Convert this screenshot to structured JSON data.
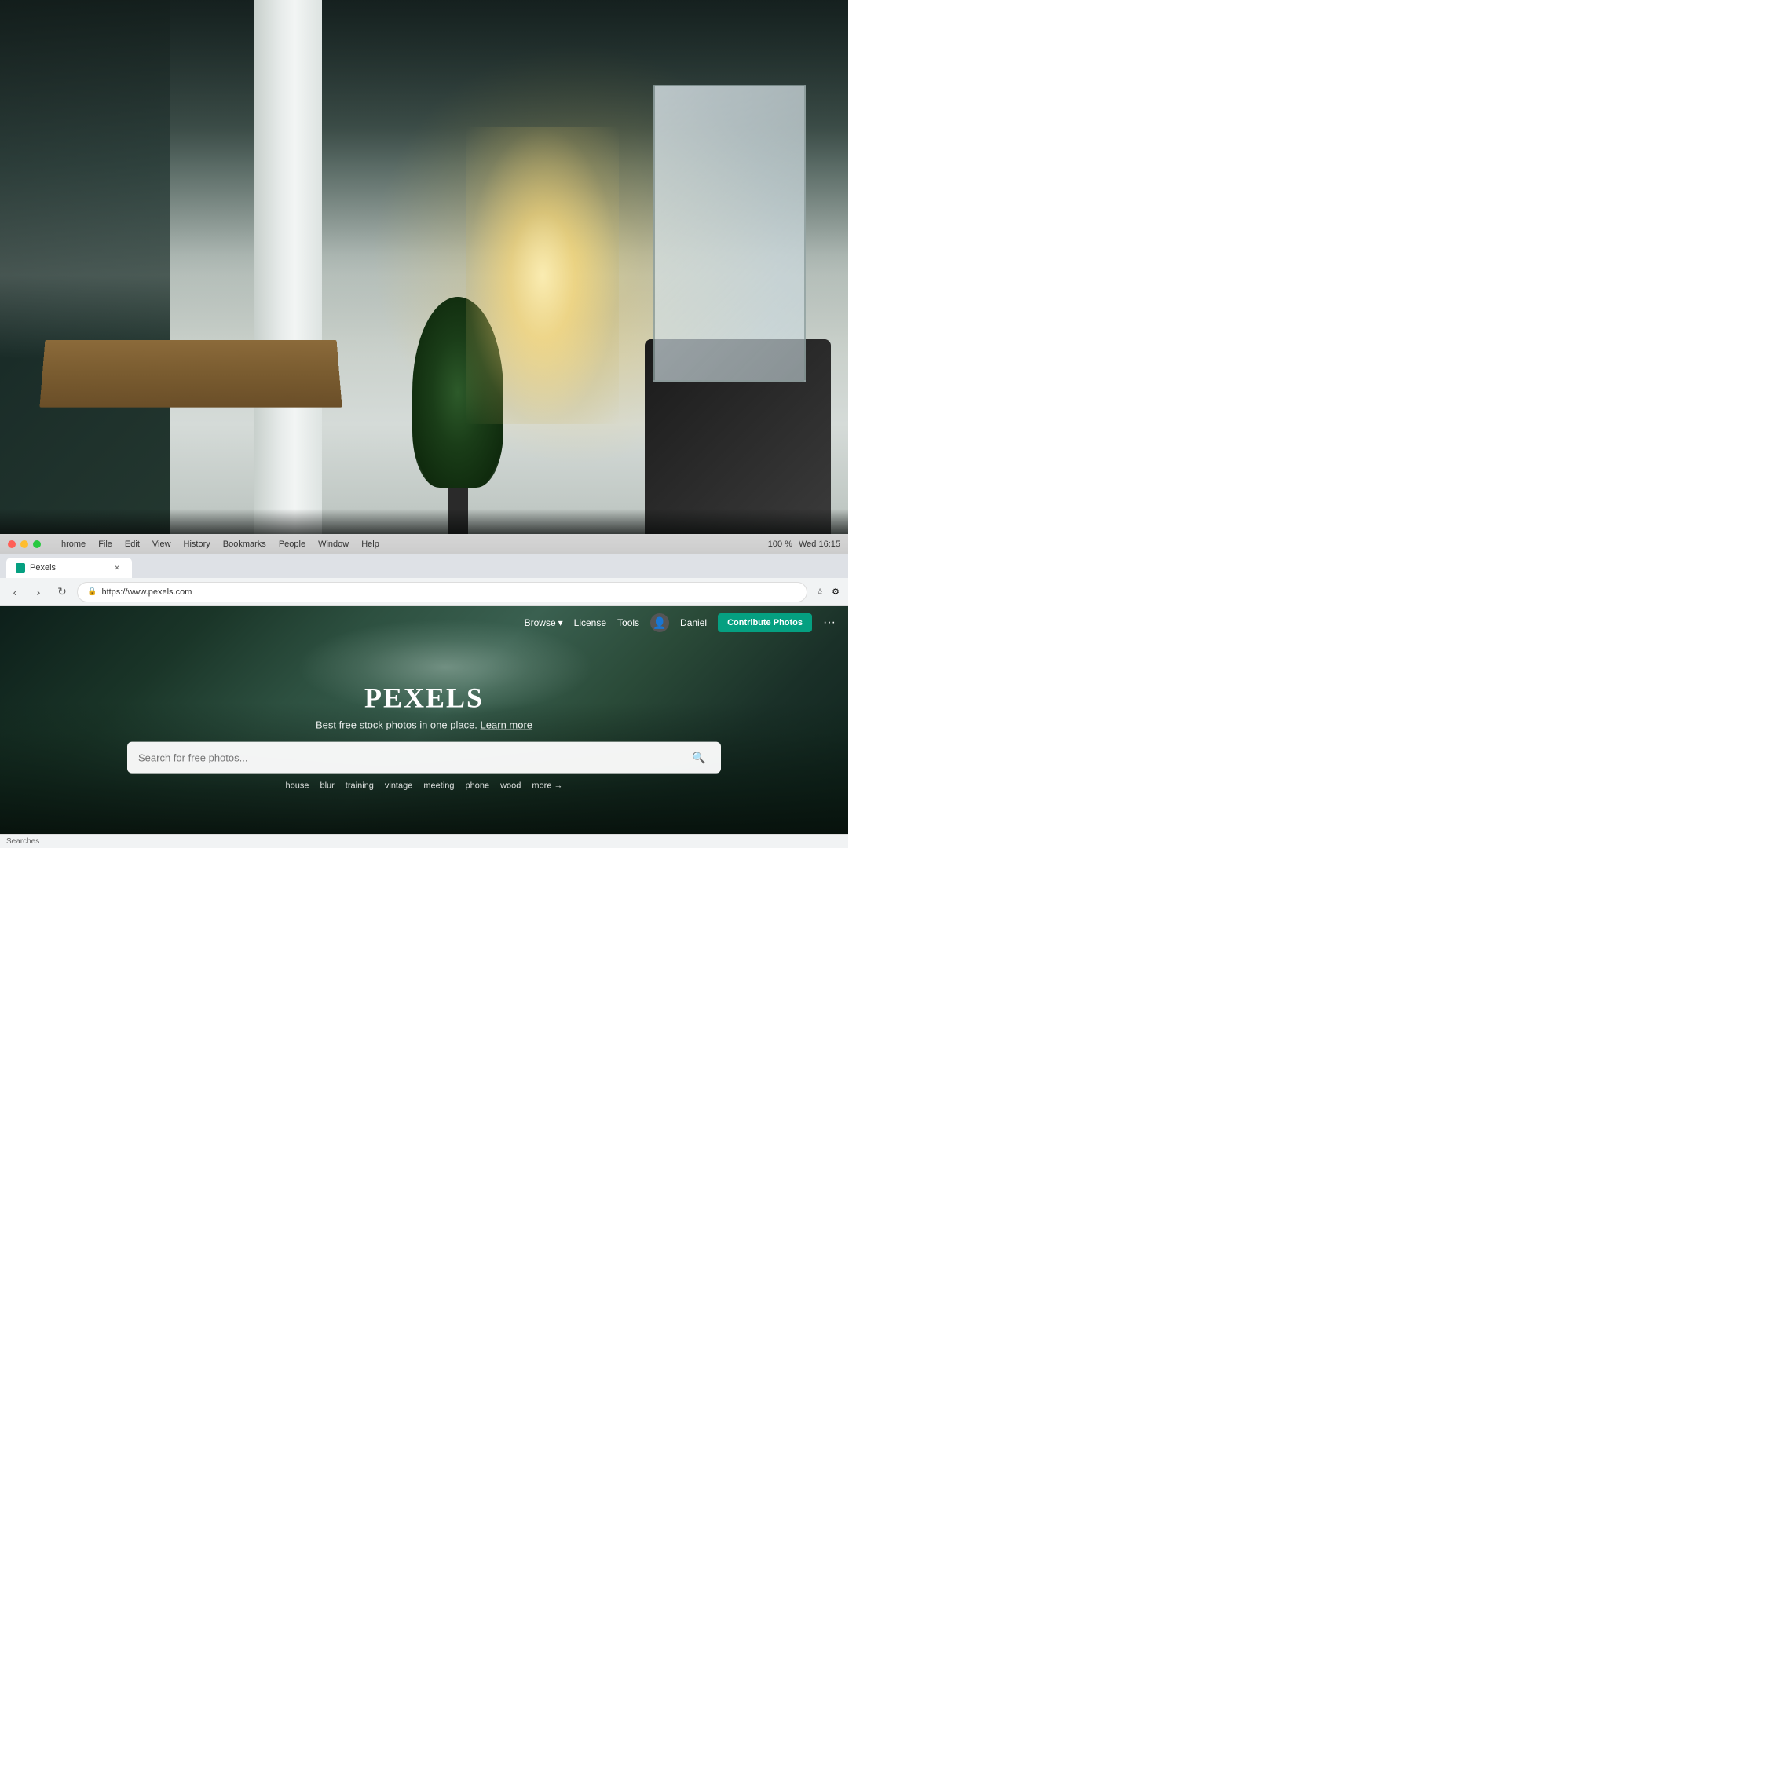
{
  "background": {
    "description": "Office workspace background photo"
  },
  "browser": {
    "titlebar": {
      "menu_items": [
        "hrome",
        "File",
        "Edit",
        "View",
        "History",
        "Bookmarks",
        "People",
        "Window",
        "Help"
      ],
      "right_info": "Wed 16:15",
      "zoom_level": "100 %"
    },
    "tab": {
      "label": "Pexels",
      "url": "https://www.pexels.com",
      "secure_label": "Secure"
    },
    "address": {
      "url": "https://www.pexels.com"
    }
  },
  "pexels": {
    "nav": {
      "browse_label": "Browse",
      "license_label": "License",
      "tools_label": "Tools",
      "user_name": "Daniel",
      "contribute_btn": "Contribute Photos",
      "more_btn": "···"
    },
    "hero": {
      "logo": "PEXELS",
      "tagline": "Best free stock photos in one place.",
      "learn_more": "Learn more",
      "search_placeholder": "Search for free photos...",
      "suggestions": [
        "house",
        "blur",
        "training",
        "vintage",
        "meeting",
        "phone",
        "wood",
        "more →"
      ]
    }
  },
  "status_bar": {
    "text": "Searches"
  }
}
